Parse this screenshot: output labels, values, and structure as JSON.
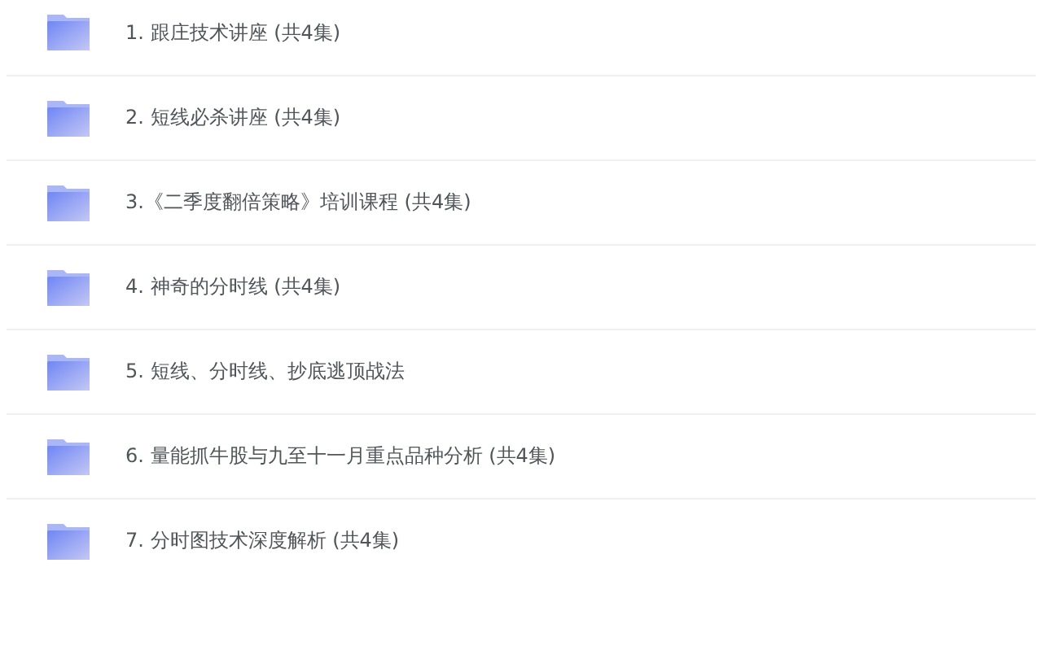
{
  "folders": [
    {
      "title": "1. 跟庄技术讲座 (共4集)"
    },
    {
      "title": "2. 短线必杀讲座 (共4集)"
    },
    {
      "title": "3.《二季度翻倍策略》培训课程 (共4集)"
    },
    {
      "title": "4. 神奇的分时线 (共4集)"
    },
    {
      "title": "5. 短线、分时线、抄底逃顶战法"
    },
    {
      "title": "6. 量能抓牛股与九至十一月重点品种分析 (共4集)"
    },
    {
      "title": "7. 分时图技术深度解析 (共4集)"
    }
  ]
}
